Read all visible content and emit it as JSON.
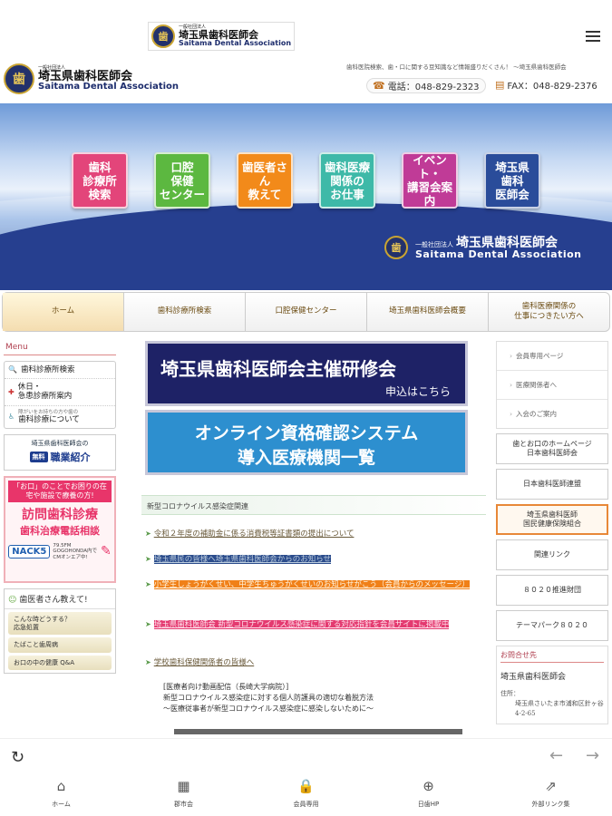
{
  "appbar": {
    "logo_small": "一般社団法人",
    "logo_jp": "埼玉県歯科医師会",
    "logo_en": "Saitama Dental Association"
  },
  "header": {
    "logo_small": "一般社団法人",
    "logo_jp": "埼玉県歯科医師会",
    "logo_en": "Saitama Dental Association",
    "tagline": "歯科医院検索、歯・口に関する豆知識など情報盛りだくさん！ ～埼玉県歯科医師会",
    "phone": "電話：048-829-2323",
    "fax": "FAX：048-829-2376"
  },
  "banner": {
    "tiles": [
      {
        "label": "歯科\n診療所\n検索",
        "color": "#e3457a"
      },
      {
        "label": "口腔\n保健\nセンター",
        "color": "#5cb840"
      },
      {
        "label": "歯医者さん\n教えて",
        "color": "#f28a1a"
      },
      {
        "label": "歯科医療\n関係の\nお仕事",
        "color": "#3eb9a8"
      },
      {
        "label": "イベント・\n講習会案内",
        "color": "#c03b97"
      },
      {
        "label": "埼玉県\n歯科\n医師会",
        "color": "#2a4c9a"
      }
    ],
    "brand_small": "一般社団法人",
    "brand_jp": "埼玉県歯科医師会",
    "brand_en": "Saitama Dental Association"
  },
  "nav": {
    "items": [
      "ホーム",
      "歯科診療所検索",
      "口腔保健センター",
      "埼玉県歯科医師会概要",
      "歯科医療関係の\n仕事につきたい方へ"
    ]
  },
  "sidebar_left": {
    "menu_heading": "Menu",
    "items": [
      {
        "label": "歯科診療所検索",
        "sub": ""
      },
      {
        "label": "休日・\n急患診療所案内",
        "sub": ""
      },
      {
        "label": "歯科診療について",
        "sub": "障がいをお持ちの方や歯の"
      }
    ],
    "jobs_top": "埼玉県歯科医師会の",
    "jobs_badge": "無料",
    "jobs_title": "職業紹介",
    "visit_header": "「お口」のことでお困りの在宅や施設で療養の方!",
    "visit_big": "訪問歯科診療",
    "visit_big2": "歯科治療電話相談",
    "visit_radio": "NACK5",
    "visit_freq": "79.5FM\nGOGOHONDA内で\nCMオンエア中!",
    "qa_heading": "歯医者さん教えて!",
    "qa_items": [
      "こんな時どうする？\n応急処置",
      "たばこと歯周病",
      "お口の中の健康 Q&A"
    ]
  },
  "main": {
    "seminar_title": "埼玉県歯科医師会主催研修会",
    "seminar_sub": "申込はこちら",
    "online_line1": "オンライン資格確認システム",
    "online_line2": "導入医療機関一覧",
    "news_header": "新型コロナウイルス感染症関連",
    "news": [
      "令和２年度の補助金に係る消費税等証書類の提出について",
      "埼玉県民の皆様へ埼玉県歯科医師会からのお知らせ",
      "小学生しょうがくせい、中学生ちゅうがくせいのお知らせがこう（会員からのメッセージ）",
      "埼玉県歯科医師会 新型コロナウイルス感染症に関する対応指針を会員サイトに掲載中",
      "学校歯科保健関係者の皆様へ"
    ],
    "dental_lines": [
      "[医療者向け動画配信（長崎大学病院）]",
      "新型コロナウイルス感染症に対する個人防護具の適切な着脱方法",
      "～医療従事者が新型コロナウイルス感染症に感染しないために～"
    ]
  },
  "sidebar_right": {
    "member_items": [
      "会員専用ページ",
      "医療関係者へ",
      "入会のご案内"
    ],
    "links": [
      "歯とお口のホームページ\n日本歯科医師会",
      "日本歯科医師連盟",
      "埼玉県歯科医師\n国民健康保険組合",
      "関連リンク",
      "８０２０推進財団",
      "テーマパーク８０２０"
    ],
    "contact_heading": "お問合せ先",
    "contact_name": "埼玉県歯科医師会",
    "contact_addr_label": "住所：",
    "contact_addr": "埼玉県さいたま市浦和区針ヶ谷4-2-65"
  },
  "tabbar": {
    "items": [
      {
        "label": "ホーム",
        "icon": "home-icon"
      },
      {
        "label": "郡市会",
        "icon": "building-icon"
      },
      {
        "label": "会員専用",
        "icon": "lock-icon"
      },
      {
        "label": "日歯HP",
        "icon": "globe-icon"
      },
      {
        "label": "外部リンク集",
        "icon": "external-link-icon"
      }
    ]
  }
}
